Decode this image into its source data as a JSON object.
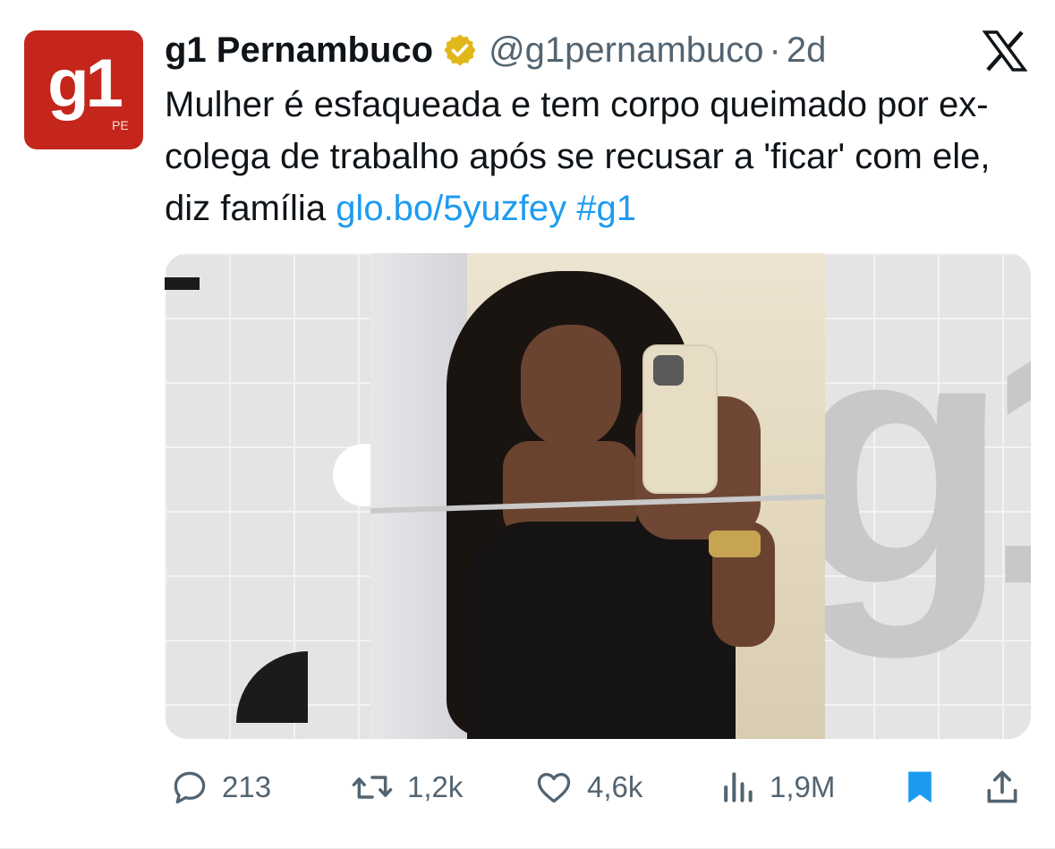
{
  "account": {
    "display_name": "g1 Pernambuco",
    "handle": "@g1pernambuco",
    "separator": "·",
    "time": "2d",
    "avatar_logo": "g1",
    "avatar_sub": "PE",
    "verified_color": "#e2b719",
    "brand_color": "#c4261b"
  },
  "tweet": {
    "text": "Mulher é esfaqueada e tem corpo queimado por ex-colega de trabalho após se recusar a 'ficar' com ele, diz família",
    "link": "glo.bo/5yuzfey",
    "hashtag": "#g1",
    "link_color": "#1d9bf0"
  },
  "media": {
    "watermark": "g1"
  },
  "actions": {
    "replies": "213",
    "retweets": "1,2k",
    "likes": "4,6k",
    "views": "1,9M",
    "bookmark_color": "#1d9bf0",
    "icons": [
      "reply-icon",
      "retweet-icon",
      "like-icon",
      "views-icon",
      "bookmark-icon",
      "share-icon"
    ]
  }
}
